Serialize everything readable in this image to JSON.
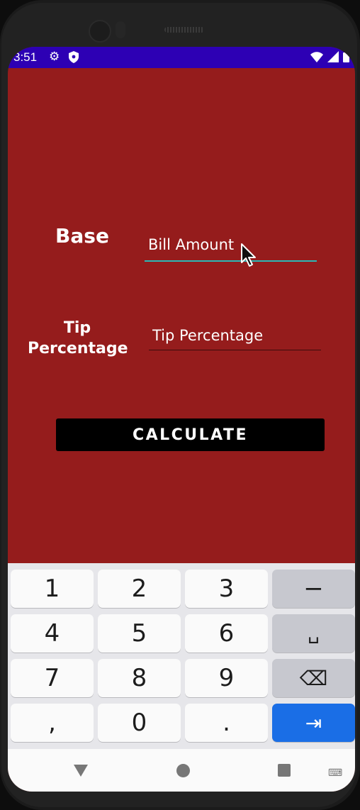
{
  "status_bar": {
    "time": "3:51",
    "settings_icon": "gear-icon",
    "shield_icon": "shield-icon",
    "wifi_icon": "wifi-icon",
    "signal_icon": "signal-icon",
    "battery_icon": "battery-icon",
    "color": "#2d00b4"
  },
  "form": {
    "base_label": "Base",
    "bill_placeholder": "Bill Amount",
    "tip_label": "Tip Percentage",
    "tip_placeholder": "Tip Percentage",
    "calculate_label": "CALCULATE",
    "background_color": "#951c1c",
    "accent_color": "#2ab9b7"
  },
  "keyboard": {
    "keys": [
      "1",
      "2",
      "3",
      "−",
      "4",
      "5",
      "6",
      "␣",
      "7",
      "8",
      "9",
      "⌫",
      ",",
      "0",
      ".",
      "⇥"
    ],
    "action_color": "#1a6ee6"
  },
  "nav_bar": {
    "back_icon": "triangle-back-icon",
    "home_icon": "circle-home-icon",
    "recents_icon": "square-recents-icon",
    "keyboard_icon": "keyboard-icon"
  }
}
